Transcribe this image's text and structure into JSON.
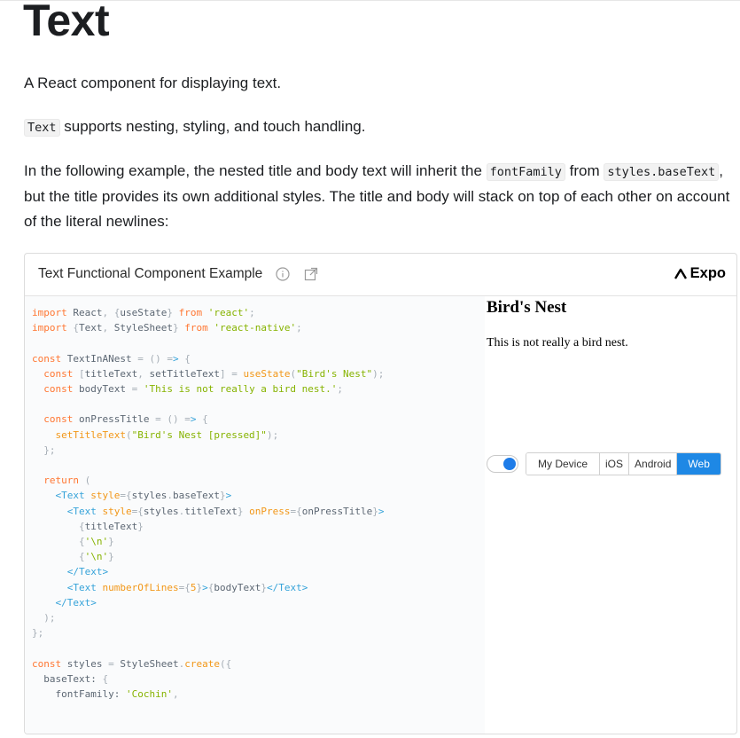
{
  "page": {
    "title": "Text",
    "intro": "A React component for displaying text.",
    "supports": {
      "code": "Text",
      "text": " supports nesting, styling, and touch handling."
    },
    "example_desc": {
      "part1": "In the following example, the nested title and body text will inherit the ",
      "code1": "fontFamily",
      "part2": " from ",
      "code2": "styles.baseText",
      "part3": ", but the title provides its own additional styles. The title and body will stack on top of each other on account of the literal newlines:"
    }
  },
  "snack": {
    "title": "Text Functional Component Example",
    "brand": "Expo",
    "code_lines": [
      "import React, {useState} from 'react';",
      "import {Text, StyleSheet} from 'react-native';",
      "",
      "const TextInANest = () => {",
      "  const [titleText, setTitleText] = useState(\"Bird's Nest\");",
      "  const bodyText = 'This is not really a bird nest.';",
      "",
      "  const onPressTitle = () => {",
      "    setTitleText(\"Bird's Nest [pressed]\");",
      "  };",
      "",
      "  return (",
      "    <Text style={styles.baseText}>",
      "      <Text style={styles.titleText} onPress={onPressTitle}>",
      "        {titleText}",
      "        {'\\n'}",
      "        {'\\n'}",
      "      </Text>",
      "      <Text numberOfLines={5}>{bodyText}</Text>",
      "    </Text>",
      "  );",
      "};",
      "",
      "const styles = StyleSheet.create({",
      "  baseText: {",
      "    fontFamily: 'Cochin',"
    ],
    "preview": {
      "title": "Bird's Nest",
      "body": "This is not really a bird nest."
    },
    "toolbar": {
      "toggle_on": true,
      "platforms": [
        "My Device",
        "iOS",
        "Android",
        "Web"
      ],
      "selected": "Web"
    }
  },
  "colors": {
    "accent": "#1e88e5",
    "keyword": "#ff7733",
    "string": "#86b300",
    "tag": "#36a3d9"
  }
}
